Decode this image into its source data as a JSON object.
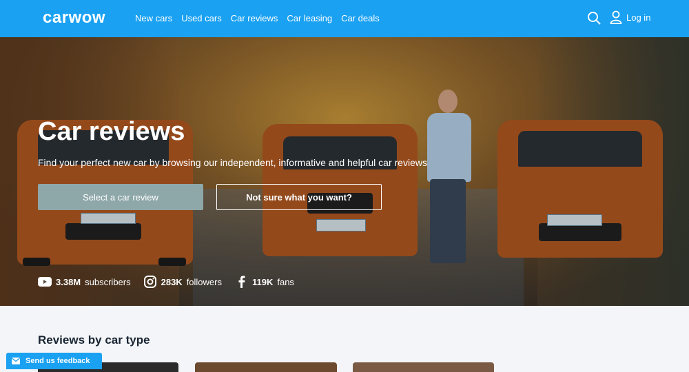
{
  "header": {
    "logo": "carwow",
    "nav": [
      "New cars",
      "Used cars",
      "Car reviews",
      "Car leasing",
      "Car deals"
    ],
    "login_label": "Log in"
  },
  "hero": {
    "title": "Car reviews",
    "subtitle": "Find your perfect new car by browsing our independent, informative and helpful car reviews",
    "primary_button": "Select a car review",
    "secondary_button": "Not sure what you want?",
    "social": {
      "youtube": {
        "count": "3.38M",
        "label": "subscribers"
      },
      "instagram": {
        "count": "283K",
        "label": "followers"
      },
      "facebook": {
        "count": "119K",
        "label": "fans"
      }
    }
  },
  "section": {
    "title": "Reviews by car type"
  },
  "feedback": {
    "label": "Send us feedback"
  },
  "colors": {
    "brand": "#1aa1f2",
    "primary_button": "#8ea7a9",
    "page_background": "#f3f5f8"
  }
}
